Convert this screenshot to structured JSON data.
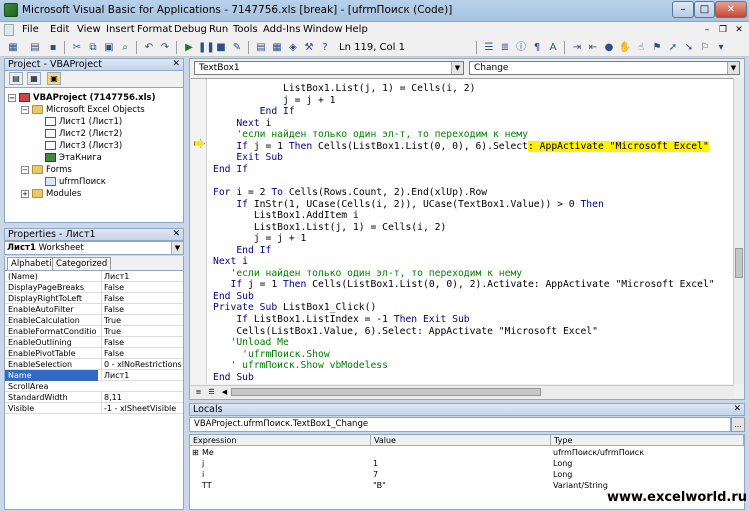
{
  "window": {
    "title": "Microsoft Visual Basic for Applications - 7147756.xls [break] - [ufrmПоиск (Code)]",
    "min": "–",
    "max": "□",
    "close": "✕"
  },
  "menu": [
    "File",
    "Edit",
    "View",
    "Insert",
    "Format",
    "Debug",
    "Run",
    "Tools",
    "Add-Ins",
    "Window",
    "Help"
  ],
  "toolbar": {
    "position": "Ln 119, Col 1"
  },
  "project": {
    "title": "Project - VBAProject",
    "close": "✕",
    "nodes": [
      {
        "label": "VBAProject (7147756.xls)",
        "icon": "project-icon",
        "bold": true
      },
      {
        "label": "Microsoft Excel Objects",
        "icon": "folder-icon"
      },
      {
        "label": "Лист1 (Лист1)",
        "icon": "sheet-icon"
      },
      {
        "label": "Лист2 (Лист2)",
        "icon": "sheet-icon"
      },
      {
        "label": "Лист3 (Лист3)",
        "icon": "sheet-icon"
      },
      {
        "label": "ЭтаКнига",
        "icon": "workbook-icon"
      },
      {
        "label": "Forms",
        "icon": "folder-icon"
      },
      {
        "label": "ufrmПоиск",
        "icon": "form-icon"
      },
      {
        "label": "Modules",
        "icon": "folder-icon"
      }
    ]
  },
  "properties": {
    "title": "Properties - Лист1",
    "close": "✕",
    "object_name": "Лист1",
    "object_type": "Worksheet",
    "tabs": [
      "Alphabetic",
      "Categorized"
    ],
    "rows": [
      {
        "name": "(Name)",
        "value": "Лист1"
      },
      {
        "name": "DisplayPageBreaks",
        "value": "False"
      },
      {
        "name": "DisplayRightToLeft",
        "value": "False"
      },
      {
        "name": "EnableAutoFilter",
        "value": "False"
      },
      {
        "name": "EnableCalculation",
        "value": "True"
      },
      {
        "name": "EnableFormatConditionsCalculation",
        "value": "True"
      },
      {
        "name": "EnableOutlining",
        "value": "False"
      },
      {
        "name": "EnablePivotTable",
        "value": "False"
      },
      {
        "name": "EnableSelection",
        "value": "0 - xlNoRestrictions"
      },
      {
        "name": "Name",
        "value": "Лист1"
      },
      {
        "name": "ScrollArea",
        "value": ""
      },
      {
        "name": "StandardWidth",
        "value": "8,11"
      },
      {
        "name": "Visible",
        "value": "-1 - xlSheetVisible"
      }
    ]
  },
  "code": {
    "object_combo": "TextBox1",
    "proc_combo": "Change",
    "lines": [
      [
        [
          "            ListBox1.List(j, 1) = Cells(i, 2)",
          "n"
        ]
      ],
      [
        [
          "            j = j + 1",
          "n"
        ]
      ],
      [
        [
          "        End If",
          "k"
        ]
      ],
      [
        [
          "    Next",
          "k"
        ],
        [
          " i",
          "n"
        ]
      ],
      [
        [
          "    'если найден только один эл-т, то переходим к нему",
          "c"
        ]
      ],
      [
        [
          "    If",
          "k"
        ],
        [
          " j = 1 ",
          "n"
        ],
        [
          "Then",
          "k"
        ],
        [
          " Cells(ListBox1.List(0, 0), 6).Select",
          "n"
        ],
        [
          ": AppActivate \"Microsoft Excel\"",
          "h"
        ]
      ],
      [
        [
          "    Exit Sub",
          "k"
        ]
      ],
      [
        [
          "End If",
          "k"
        ]
      ],
      [
        [
          "",
          "n"
        ]
      ],
      [
        [
          "For",
          "k"
        ],
        [
          " i = 2 ",
          "n"
        ],
        [
          "To",
          "k"
        ],
        [
          " Cells(Rows.Count, 2).End(xlUp).Row",
          "n"
        ]
      ],
      [
        [
          "    If",
          "k"
        ],
        [
          " InStr(1, UCase(Cells(i, 2)), UCase(TextBox1.Value)) > 0 ",
          "n"
        ],
        [
          "Then",
          "k"
        ]
      ],
      [
        [
          "       ListBox1.AddItem i",
          "n"
        ]
      ],
      [
        [
          "       ListBox1.List(j, 1) = Cells(i, 2)",
          "n"
        ]
      ],
      [
        [
          "       j = j + 1",
          "n"
        ]
      ],
      [
        [
          "    End If",
          "k"
        ]
      ],
      [
        [
          "Next",
          "k"
        ],
        [
          " i",
          "n"
        ]
      ],
      [
        [
          "   'если найден только один эл-т, то переходим к нему",
          "c"
        ]
      ],
      [
        [
          "   If",
          "k"
        ],
        [
          " j = 1 ",
          "n"
        ],
        [
          "Then",
          "k"
        ],
        [
          " Cells(ListBox1.List(0, 0), 2).Activate: AppActivate \"Microsoft Excel\"",
          "n"
        ]
      ],
      [
        [
          "End Sub",
          "k"
        ]
      ],
      [
        [
          "Private Sub",
          "k"
        ],
        [
          " ListBox1_Click()",
          "n"
        ]
      ],
      [
        [
          "    If",
          "k"
        ],
        [
          " ListBox1.ListIndex = -1 ",
          "n"
        ],
        [
          "Then Exit Sub",
          "k"
        ]
      ],
      [
        [
          "    Cells(ListBox1.Value, 6).Select: AppActivate \"Microsoft Excel\"",
          "n"
        ]
      ],
      [
        [
          "   'Unload Me",
          "c"
        ]
      ],
      [
        [
          "     'ufrmПоиск.Show",
          "c"
        ]
      ],
      [
        [
          "   ' ufrmПоиск.Show vbModeless",
          "c"
        ]
      ],
      [
        [
          "End Sub",
          "k"
        ]
      ]
    ]
  },
  "locals": {
    "title": "Locals",
    "close": "✕",
    "context": "VBAProject.ufrmПоиск.TextBox1_Change",
    "ellipsis": "...",
    "headers": [
      "Expression",
      "Value",
      "Type"
    ],
    "rows": [
      {
        "expr": "Me",
        "value": "",
        "type": "ufrmПоиск/ufrmПоиск",
        "expandable": true
      },
      {
        "expr": "j",
        "value": "1",
        "type": "Long"
      },
      {
        "expr": "i",
        "value": "7",
        "type": "Long"
      },
      {
        "expr": "TT",
        "value": "\"В\"",
        "type": "Variant/String"
      }
    ]
  },
  "watermark": "www.excelworld.ru"
}
